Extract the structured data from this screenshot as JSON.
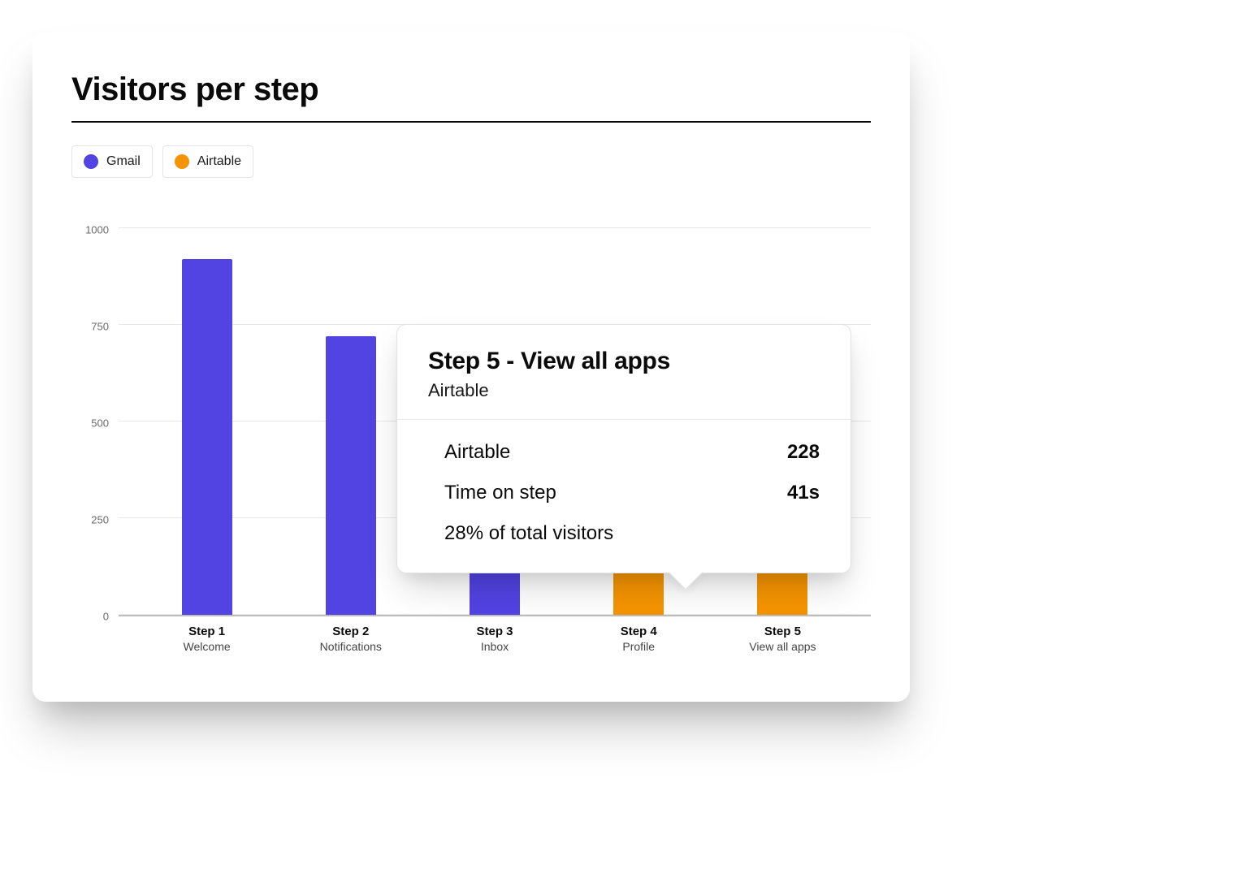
{
  "title": "Visitors per step",
  "legend": [
    {
      "name": "Gmail",
      "color": "#5243e3"
    },
    {
      "name": "Airtable",
      "color": "#f59400"
    }
  ],
  "chart_data": {
    "type": "bar",
    "title": "Visitors per step",
    "xlabel": "",
    "ylabel": "",
    "ylim": [
      0,
      1050
    ],
    "y_ticks": [
      0,
      250,
      500,
      750,
      1000
    ],
    "categories": [
      {
        "step": "Step 1",
        "sub": "Welcome"
      },
      {
        "step": "Step 2",
        "sub": "Notifications"
      },
      {
        "step": "Step 3",
        "sub": "Inbox"
      },
      {
        "step": "Step 4",
        "sub": "Profile"
      },
      {
        "step": "Step 5",
        "sub": "View all apps"
      }
    ],
    "series": [
      {
        "name": "Gmail",
        "color": "#5243e3",
        "values": [
          920,
          720,
          300,
          null,
          null
        ]
      },
      {
        "name": "Airtable",
        "color": "#f59400",
        "values": [
          null,
          null,
          null,
          300,
          228
        ]
      }
    ]
  },
  "tooltip": {
    "title": "Step 5 - View all apps",
    "subtitle": "Airtable",
    "rows": [
      {
        "label": "Airtable",
        "value": "228"
      },
      {
        "label": "Time on step",
        "value": "41s"
      }
    ],
    "footer": "28% of total visitors"
  }
}
